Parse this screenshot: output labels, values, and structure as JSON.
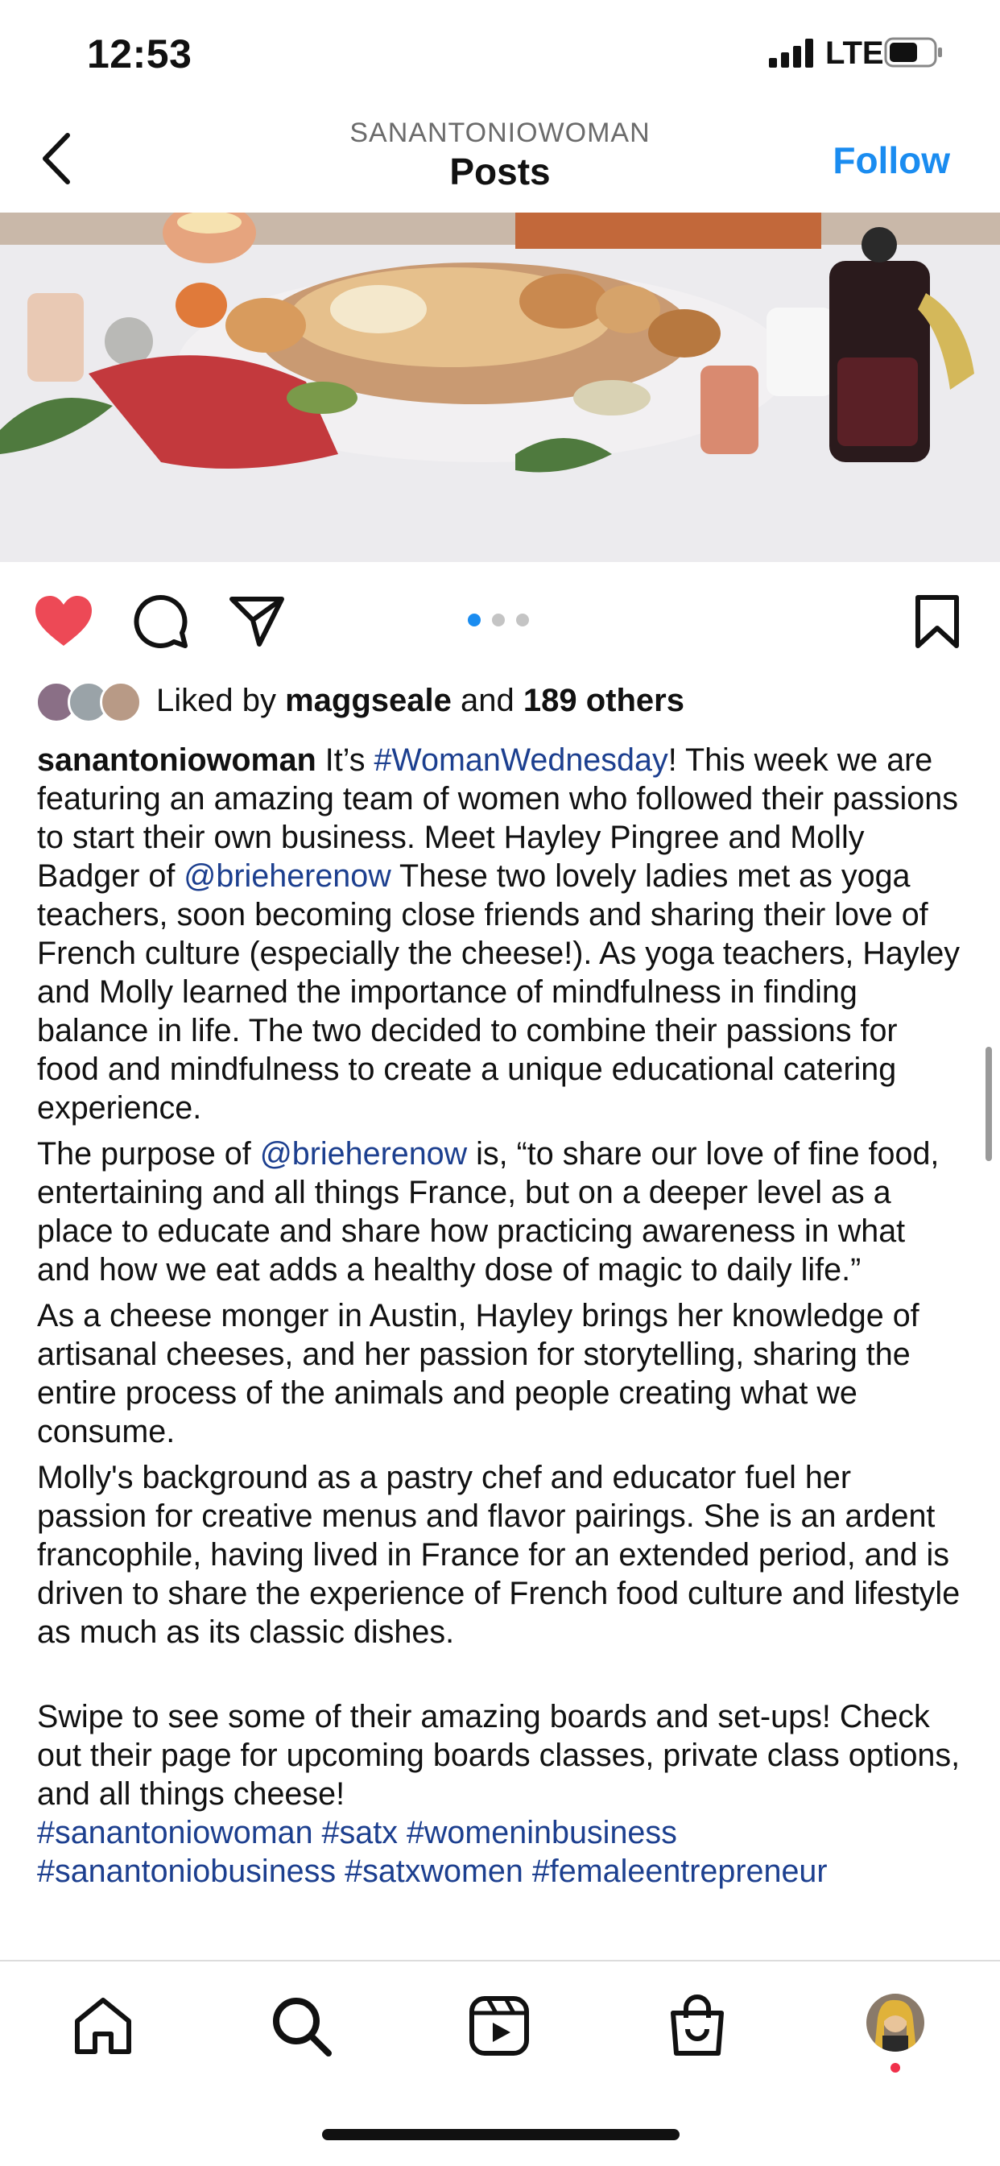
{
  "status_bar": {
    "time": "12:53",
    "network": "LTE",
    "icons": [
      "signal-icon",
      "battery-icon"
    ]
  },
  "header": {
    "account": "SANANTONIOWOMAN",
    "title": "Posts",
    "follow_label": "Follow",
    "back_icon": "chevron-left-icon"
  },
  "post": {
    "carousel": {
      "current": 1,
      "total": 3,
      "active_color": "#1a8cf0"
    },
    "actions": {
      "like_icon": "heart-icon",
      "liked": true,
      "comment_icon": "comment-icon",
      "share_icon": "paper-plane-icon",
      "save_icon": "bookmark-icon"
    },
    "likes": {
      "prefix": "Liked by",
      "user": "maggseale",
      "joiner": "and",
      "others": "189 others"
    },
    "caption": {
      "username": "sanantoniowoman",
      "p1_a": " It’s ",
      "hashtag_1": "#WomanWednesday",
      "p1_b": "! This week we are featuring an amazing team of women who followed their passions to start their own business. Meet Hayley Pingree and Molly Badger of ",
      "mention_1": "@brieherenow",
      "p1_c": " These two lovely ladies met as yoga teachers, soon becoming close friends and sharing their love of French culture (especially the cheese!). As yoga teachers, Hayley and Molly learned the importance of mindfulness in finding balance in life. The two decided to combine their passions for food and mindfulness to create a unique educational catering experience.",
      "p2_a": "The purpose of ",
      "mention_2": "@brieherenow",
      "p2_b": " is, “to share our love of fine food, entertaining and all things France, but on a deeper level as a place to educate and share how practicing awareness in what and how we eat adds a healthy dose of magic to daily life.”",
      "p3": "As a cheese monger in Austin, Hayley brings her knowledge of artisanal cheeses, and her passion for storytelling, sharing the entire process of the animals and people creating what we consume.",
      "p4": "Molly's background as a pastry chef and educator fuel her passion for creative menus and flavor pairings.  She is an ardent francophile, having lived in France for an extended period, and is driven to share the experience of French food culture and lifestyle as much as its classic dishes.",
      "p5": "Swipe to see some of their amazing boards and set-ups! Check out their page for upcoming boards classes, private class options, and all things cheese!",
      "hashtags_line1": "#sanantoniowoman #satx #womeninbusiness",
      "hashtags_line2": "#sanantoniobusiness #satxwomen #femaleentrepreneur"
    }
  },
  "tab_bar": {
    "items": [
      "home-icon",
      "search-icon",
      "reels-icon",
      "shop-icon",
      "profile-avatar"
    ],
    "notification_dot_color": "#f0304a"
  }
}
